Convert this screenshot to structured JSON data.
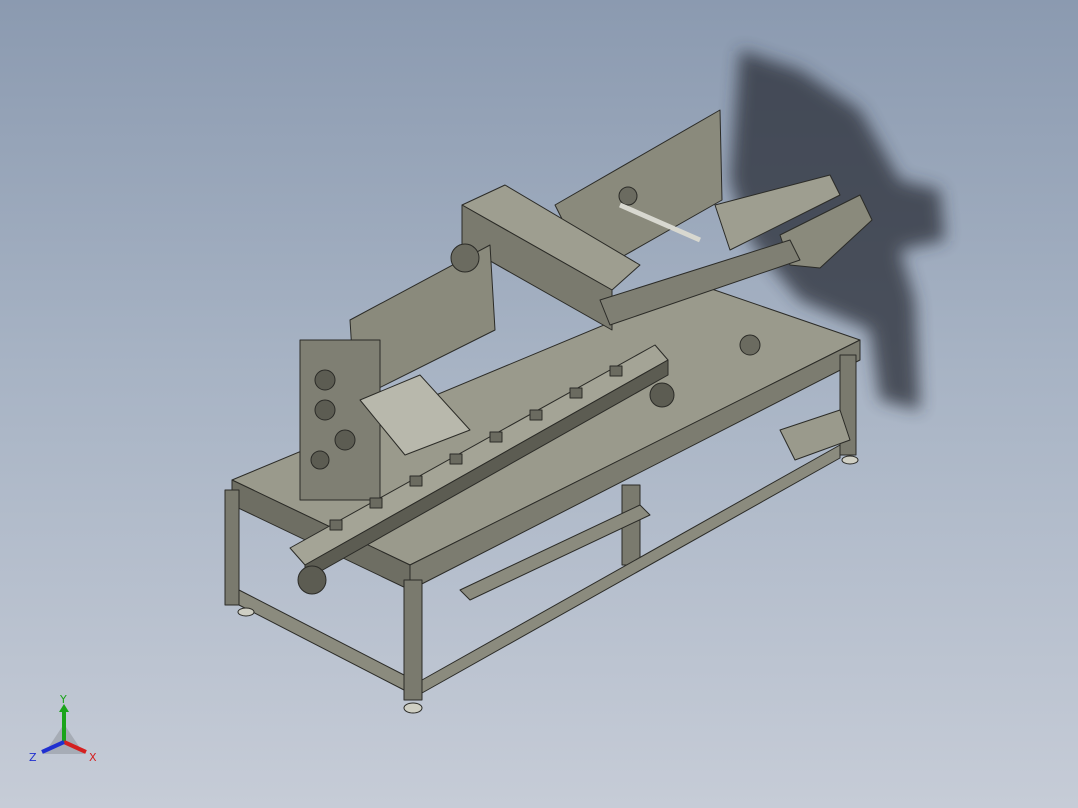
{
  "viewport": {
    "background_top": "#8b9ab0",
    "background_bottom": "#c6ccd7",
    "model": {
      "subject": "packaging-machine-assembly",
      "display_mode": "shaded-with-edges",
      "shadow": true,
      "colors": {
        "metal": "#8a8a7c",
        "metal_dark": "#5c5c52",
        "edge": "#2b2b27",
        "shadow": "#2a2f38"
      }
    },
    "triad": {
      "labels": {
        "x": "X",
        "y": "Y",
        "z": "Z"
      },
      "colors": {
        "x": "#d42020",
        "y": "#1aa41a",
        "z": "#2030d0"
      }
    }
  }
}
